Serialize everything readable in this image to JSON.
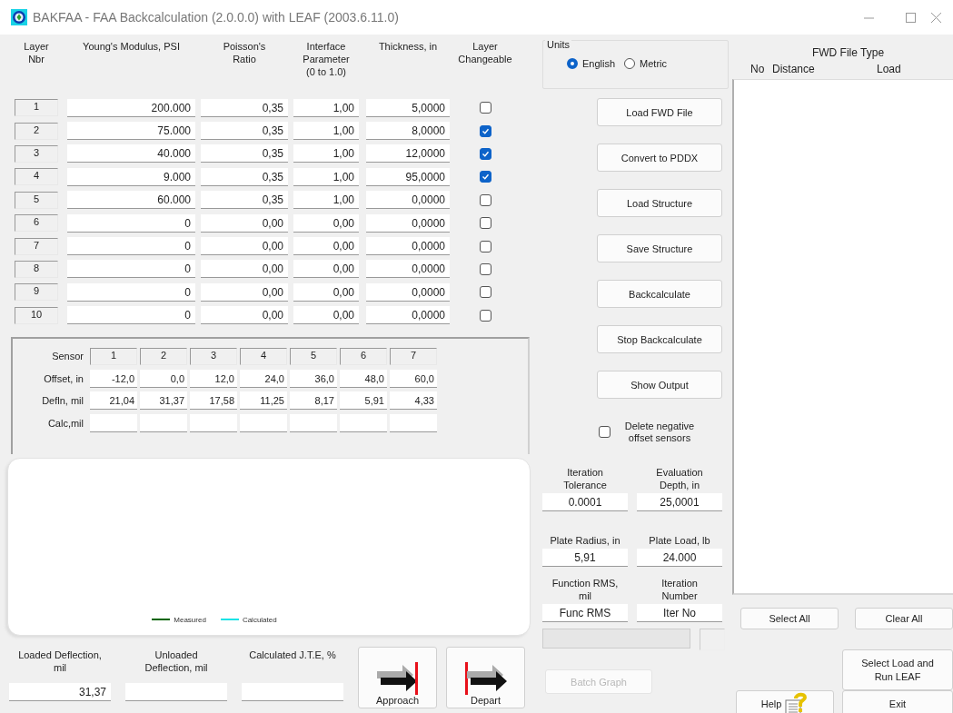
{
  "window": {
    "title": "BAKFAA - FAA Backcalculation (2.0.0.0) with LEAF (2003.6.11.0)"
  },
  "layers": {
    "columns": [
      "Layer Nbr",
      "Young's Modulus, PSI",
      "Poisson's Ratio",
      "Interface Parameter (0 to 1.0)",
      "Thickness, in",
      "Layer Changeable"
    ],
    "rows": [
      {
        "nbr": "1",
        "modulus": "200.000",
        "poisson": "0,35",
        "interface": "1,00",
        "thickness": "5,0000",
        "changeable": false
      },
      {
        "nbr": "2",
        "modulus": "75.000",
        "poisson": "0,35",
        "interface": "1,00",
        "thickness": "8,0000",
        "changeable": true
      },
      {
        "nbr": "3",
        "modulus": "40.000",
        "poisson": "0,35",
        "interface": "1,00",
        "thickness": "12,0000",
        "changeable": true
      },
      {
        "nbr": "4",
        "modulus": "9.000",
        "poisson": "0,35",
        "interface": "1,00",
        "thickness": "95,0000",
        "changeable": true
      },
      {
        "nbr": "5",
        "modulus": "60.000",
        "poisson": "0,35",
        "interface": "1,00",
        "thickness": "0,0000",
        "changeable": false
      },
      {
        "nbr": "6",
        "modulus": "0",
        "poisson": "0,00",
        "interface": "0,00",
        "thickness": "0,0000",
        "changeable": false
      },
      {
        "nbr": "7",
        "modulus": "0",
        "poisson": "0,00",
        "interface": "0,00",
        "thickness": "0,0000",
        "changeable": false
      },
      {
        "nbr": "8",
        "modulus": "0",
        "poisson": "0,00",
        "interface": "0,00",
        "thickness": "0,0000",
        "changeable": false
      },
      {
        "nbr": "9",
        "modulus": "0",
        "poisson": "0,00",
        "interface": "0,00",
        "thickness": "0,0000",
        "changeable": false
      },
      {
        "nbr": "10",
        "modulus": "0",
        "poisson": "0,00",
        "interface": "0,00",
        "thickness": "0,0000",
        "changeable": false
      }
    ]
  },
  "sensors": {
    "row_labels": [
      "Sensor",
      "Offset, in",
      "Defln, mil",
      "Calc,mil"
    ],
    "numbers": [
      "1",
      "2",
      "3",
      "4",
      "5",
      "6",
      "7"
    ],
    "offsets": [
      "-12,0",
      "0,0",
      "12,0",
      "24,0",
      "36,0",
      "48,0",
      "60,0"
    ],
    "deflections": [
      "21,04",
      "31,37",
      "17,58",
      "11,25",
      "8,17",
      "5,91",
      "4,33"
    ]
  },
  "chart": {
    "legend": [
      {
        "name": "Measured",
        "color": "#006400"
      },
      {
        "name": "Calculated",
        "color": "#19e3e6"
      }
    ]
  },
  "bottom_fields": [
    {
      "label": "Loaded Deflection, mil",
      "value": "31,37"
    },
    {
      "label": "Unloaded Deflection, mil"
    },
    {
      "label": "Calculated J.T.E, %"
    }
  ],
  "direction_buttons": [
    {
      "label": "Approach",
      "kind": "approach"
    },
    {
      "label": "Depart",
      "kind": "depart"
    }
  ],
  "units": {
    "label": "Units",
    "options": [
      {
        "label": "English",
        "selected": true
      },
      {
        "label": "Metric",
        "selected": false
      }
    ]
  },
  "actions": [
    "Load FWD File",
    "Convert to PDDX",
    "Load Structure",
    "Save Structure",
    "Backcalculate",
    "Stop Backcalculate",
    "Show Output"
  ],
  "delete_negative": {
    "label": "Delete negative offset sensors",
    "checked": false
  },
  "parameters": [
    {
      "label": "Iteration Tolerance",
      "value": "0.0001"
    },
    {
      "label": "Evaluation Depth, in",
      "value": "25,0001"
    },
    {
      "label": "Plate Radius, in",
      "value": "5,91"
    },
    {
      "label": "Plate Load, lb",
      "value": "24.000"
    },
    {
      "label": "Function RMS, mil",
      "value": "Func RMS"
    },
    {
      "label": "Iteration Number",
      "value": "Iter No"
    }
  ],
  "batch_graph": {
    "label": "Batch Graph",
    "disabled": true
  },
  "fwd": {
    "title": "FWD File Type",
    "columns": [
      "No",
      "Distance",
      "Load"
    ]
  },
  "list_buttons": [
    "Select All",
    "Clear All"
  ],
  "select_load": "Select Load and Run LEAF",
  "help": "Help",
  "exit": "Exit"
}
